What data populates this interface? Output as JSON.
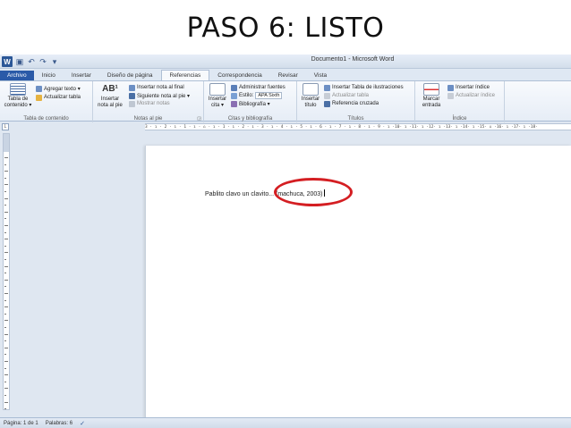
{
  "slide": {
    "title": "PASO 6: LISTO"
  },
  "window": {
    "title": "Documento1 - Microsoft Word"
  },
  "tabs": [
    "Archivo",
    "Inicio",
    "Insertar",
    "Diseño de página",
    "Referencias",
    "Correspondencia",
    "Revisar",
    "Vista"
  ],
  "active_tab": "Referencias",
  "ribbon": {
    "toc": {
      "big_label_1": "Tabla de",
      "big_label_2": "contenido ▾",
      "add_text": "Agregar texto ▾",
      "update_table": "Actualizar tabla",
      "group_label": "Tabla de contenido"
    },
    "footnotes": {
      "big_label_1": "Insertar",
      "big_label_2": "nota al pie",
      "big_icon_text": "AB¹",
      "insert_endnote": "Insertar nota al final",
      "next_footnote": "Siguiente nota al pie ▾",
      "show_notes": "Mostrar notas",
      "group_label": "Notas al pie"
    },
    "citations": {
      "big_label_1": "Insertar",
      "big_label_2": "cita ▾",
      "manage_sources": "Administrar fuentes",
      "style_label": "Estilo:",
      "style_value": "APA Sixth",
      "bibliography": "Bibliografía ▾",
      "group_label": "Citas y bibliografía"
    },
    "captions": {
      "big_label_1": "Insertar",
      "big_label_2": "título",
      "insert_table_figures": "Insertar Tabla de ilustraciones",
      "update_table": "Actualizar tabla",
      "cross_reference": "Referencia cruzada",
      "group_label": "Títulos"
    },
    "index": {
      "big_label_1": "Marcar",
      "big_label_2": "entrada",
      "insert_index": "Insertar índice",
      "update_index": "Actualizar índice",
      "group_label": "Índice"
    }
  },
  "ruler": {
    "text": "3 · ı · 2 · ı · 1 · ı · ⌂ · ı · 1 · ı · 2 · ı · 3 · ı · 4 · ı · 5 · ı · 6 · ı · 7 · ı · 8 · ı · 9 · ı ·10· ı ·11· ı ·12· ı ·13· ı ·14· ı ·15· ⌂ ·16· ı ·17· ı ·18·"
  },
  "document": {
    "text": "Pablito clavo un clavito... (machuca, 2003)"
  },
  "status": {
    "page": "Página: 1 de 1",
    "words": "Palabras: 6"
  },
  "colors": {
    "file_tab": "#2a5aa8",
    "highlight": "#d41e22",
    "ribbon_bg": "#f8fafd"
  }
}
